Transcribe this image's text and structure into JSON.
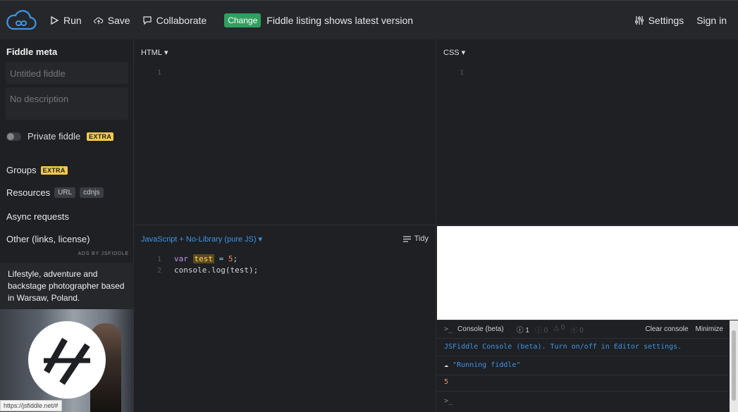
{
  "toolbar": {
    "run_label": "Run",
    "save_label": "Save",
    "collaborate_label": "Collaborate",
    "change_badge": "Change",
    "notice": "Fiddle listing shows latest version",
    "settings_label": "Settings",
    "signin_label": "Sign in"
  },
  "sidebar": {
    "meta_title": "Fiddle meta",
    "title_placeholder": "Untitled fiddle",
    "description_placeholder": "No description",
    "private_label": "Private fiddle",
    "extra_badge": "EXTRA",
    "groups_label": "Groups",
    "resources_label": "Resources",
    "resources_url_pill": "URL",
    "resources_cdnjs_pill": "cdnjs",
    "async_label": "Async requests",
    "other_label": "Other (links, license)",
    "ads_label": "ADS BY JSFIDDLE",
    "ad_text": "Lifestyle, adventure and backstage photographer based in Warsaw, Poland.",
    "status_url": "https://jsfiddle.net/#"
  },
  "html_panel": {
    "header": "HTML",
    "line_numbers": [
      "1"
    ]
  },
  "css_panel": {
    "header": "CSS",
    "line_numbers": [
      "1"
    ]
  },
  "js_panel": {
    "header": "JavaScript + No-Library (pure JS)",
    "tidy_label": "Tidy",
    "line_numbers": [
      "1",
      "2"
    ],
    "code_line1": {
      "kw": "var",
      "ident": "test",
      "op": "=",
      "num": "5",
      "end": ";"
    },
    "code_line2": "console.log(test);"
  },
  "console": {
    "title": "Console (beta)",
    "count_log": "1",
    "count_info": "0",
    "count_warn": "0",
    "count_error": "0",
    "clear_label": "Clear console",
    "minimize_label": "Minimize",
    "intro_line": "JSFiddle Console (beta). Turn on/off in Editor settings.",
    "running_line": "\"Running fiddle\"",
    "output_line": "5",
    "prompt": ">_"
  },
  "colors": {
    "accent": "#3f95e6",
    "change_badge": "#2fa05f",
    "extra_badge": "#f2c94c",
    "background": "#1e2023"
  }
}
